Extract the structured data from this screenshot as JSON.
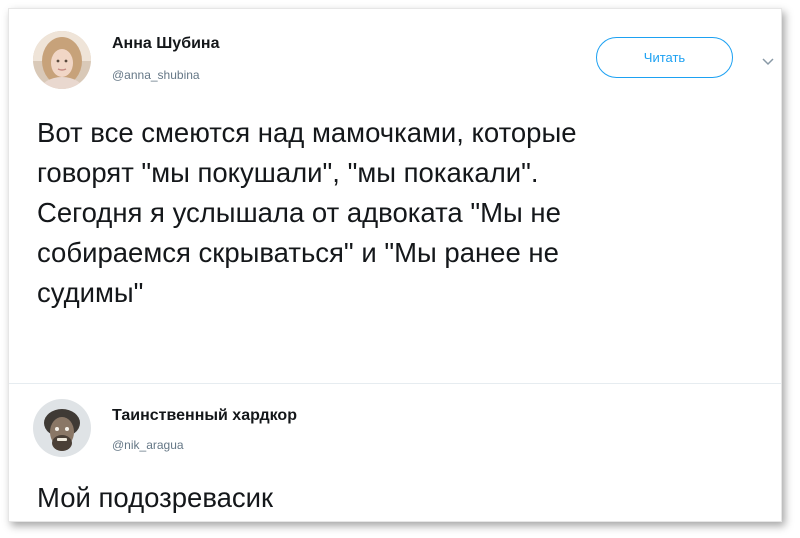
{
  "tweet1": {
    "author_name": "Анна Шубина",
    "author_handle": "@anna_shubina",
    "follow_label": "Читать",
    "text": "Вот все смеются над мамочками, которые\nговорят \"мы покушали\", \"мы покакали\".\nСегодня я услышала от адвоката \"Мы не\nсобираемся скрываться\" и \"Мы ранее не\nсудимы\""
  },
  "tweet2": {
    "author_name": "Таинственный хардкор",
    "author_handle": "@nik_aragua",
    "text": "Мой подозревасик"
  },
  "colors": {
    "accent": "#1da1f2",
    "text": "#14171a",
    "secondary_text": "#657786",
    "divider": "#e6ecf0"
  },
  "icons": {
    "menu": "chevron-down-icon"
  }
}
